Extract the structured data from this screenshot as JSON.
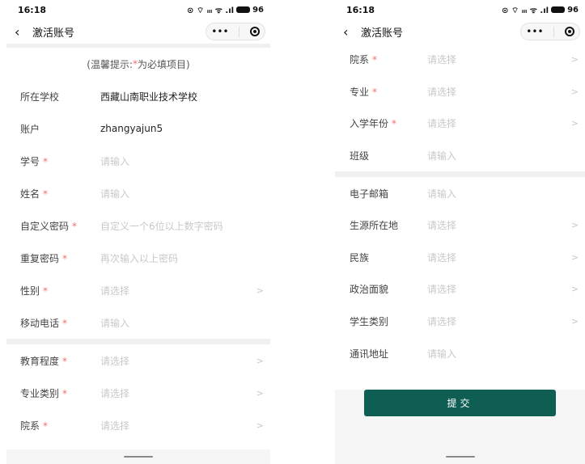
{
  "status": {
    "time": "16:18",
    "battery": "96",
    "icons_left": "⊙ ⌔ ᵢₗₗ ᯤ .ıl"
  },
  "nav": {
    "title": "激活账号",
    "back_icon": "‹",
    "more": "•••"
  },
  "tip": {
    "prefix": "(温馨提示: ",
    "star": "*",
    "suffix": " 为必填项目)"
  },
  "star": "*",
  "chevron": ">",
  "left_rows": [
    {
      "label": "所在学校",
      "required": false,
      "value": "西藏山南职业技术学校",
      "placeholder": "",
      "chevron": false
    },
    {
      "label": "账户",
      "required": false,
      "value": "zhangyajun5",
      "placeholder": "",
      "chevron": false
    },
    {
      "label": "学号",
      "required": true,
      "value": "",
      "placeholder": "请输入",
      "chevron": false
    },
    {
      "label": "姓名",
      "required": true,
      "value": "",
      "placeholder": "请输入",
      "chevron": false
    },
    {
      "label": "自定义密码",
      "required": true,
      "value": "",
      "placeholder": "自定义一个6位以上数字密码",
      "chevron": false
    },
    {
      "label": "重复密码",
      "required": true,
      "value": "",
      "placeholder": "再次输入以上密码",
      "chevron": false
    },
    {
      "label": "性别",
      "required": true,
      "value": "",
      "placeholder": "请选择",
      "chevron": true
    },
    {
      "label": "移动电话",
      "required": true,
      "value": "",
      "placeholder": "请输入",
      "chevron": false
    }
  ],
  "left_rows_2": [
    {
      "label": "教育程度",
      "required": true,
      "placeholder": "请选择",
      "chevron": true
    },
    {
      "label": "专业类别",
      "required": true,
      "placeholder": "请选择",
      "chevron": true
    },
    {
      "label": "院系",
      "required": true,
      "placeholder": "请选择",
      "chevron": true
    }
  ],
  "right_rows": [
    {
      "label": "院系",
      "required": true,
      "placeholder": "请选择",
      "chevron": true
    },
    {
      "label": "专业",
      "required": true,
      "placeholder": "请选择",
      "chevron": true
    },
    {
      "label": "入学年份",
      "required": true,
      "placeholder": "请选择",
      "chevron": true
    },
    {
      "label": "班级",
      "required": false,
      "placeholder": "请输入",
      "chevron": false
    }
  ],
  "right_rows_2": [
    {
      "label": "电子邮箱",
      "required": false,
      "placeholder": "请输入",
      "chevron": false
    },
    {
      "label": "生源所在地",
      "required": false,
      "placeholder": "请选择",
      "chevron": true
    },
    {
      "label": "民族",
      "required": false,
      "placeholder": "请选择",
      "chevron": true
    },
    {
      "label": "政治面貌",
      "required": false,
      "placeholder": "请选择",
      "chevron": true
    },
    {
      "label": "学生类别",
      "required": false,
      "placeholder": "请选择",
      "chevron": true
    },
    {
      "label": "通讯地址",
      "required": false,
      "placeholder": "请输入",
      "chevron": false
    }
  ],
  "submit_label": "提交",
  "colors": {
    "accent": "#0f5e54",
    "required_star": "#f56c6c",
    "placeholder": "#c8c8c8"
  }
}
